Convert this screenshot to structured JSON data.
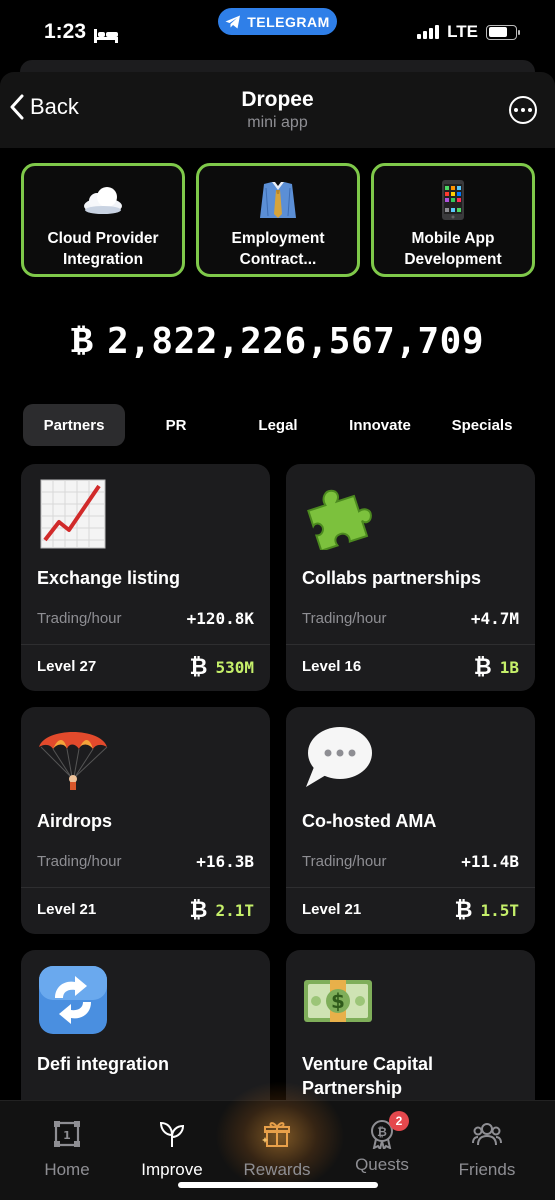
{
  "status_bar": {
    "time": "1:23",
    "telegram_pill": "TELEGRAM",
    "network": "LTE"
  },
  "header": {
    "back_label": "Back",
    "title": "Dropee",
    "subtitle": "mini app"
  },
  "combo": [
    {
      "label": "Cloud Provider Integration",
      "icon": "cloud-icon"
    },
    {
      "label": "Employment Contract...",
      "icon": "shirt-tie-icon"
    },
    {
      "label": "Mobile App Development",
      "icon": "mobile-phone-icon"
    }
  ],
  "balance": {
    "symbol": "₿",
    "amount": "2,822,226,567,709"
  },
  "tabs": [
    "Partners",
    "PR",
    "Legal",
    "Innovate",
    "Specials"
  ],
  "active_tab": "Partners",
  "cards": [
    {
      "name": "Exchange listing",
      "rate_label": "Trading/hour",
      "rate": "+120.8K",
      "level": "Level 27",
      "coin": "₿",
      "cost": "530M",
      "icon": "chart-increasing-icon"
    },
    {
      "name": "Collabs partnerships",
      "rate_label": "Trading/hour",
      "rate": "+4.7M",
      "level": "Level 16",
      "coin": "₿",
      "cost": "1B",
      "icon": "puzzle-piece-icon"
    },
    {
      "name": "Airdrops",
      "rate_label": "Trading/hour",
      "rate": "+16.3B",
      "level": "Level 21",
      "coin": "₿",
      "cost": "2.1T",
      "icon": "parachute-icon"
    },
    {
      "name": "Co-hosted AMA",
      "rate_label": "Trading/hour",
      "rate": "+11.4B",
      "level": "Level 21",
      "coin": "₿",
      "cost": "1.5T",
      "icon": "speech-bubble-icon"
    },
    {
      "name": "Defi integration",
      "icon": "arrows-cycle-icon"
    },
    {
      "name": "Venture Capital Partnership",
      "icon": "dollar-banknote-icon"
    }
  ],
  "nav": [
    {
      "label": "Home",
      "icon": "home-icon"
    },
    {
      "label": "Improve",
      "icon": "sprout-icon"
    },
    {
      "label": "Rewards",
      "icon": "gift-icon"
    },
    {
      "label": "Quests",
      "icon": "quests-icon",
      "badge": "2"
    },
    {
      "label": "Friends",
      "icon": "friends-icon"
    }
  ],
  "active_nav": "Improve",
  "colors": {
    "accent_green": "#7fc94a",
    "cost_lime": "#c5ef6a",
    "telegram_blue": "#2f7fe8",
    "badge_red": "#e5484d"
  }
}
